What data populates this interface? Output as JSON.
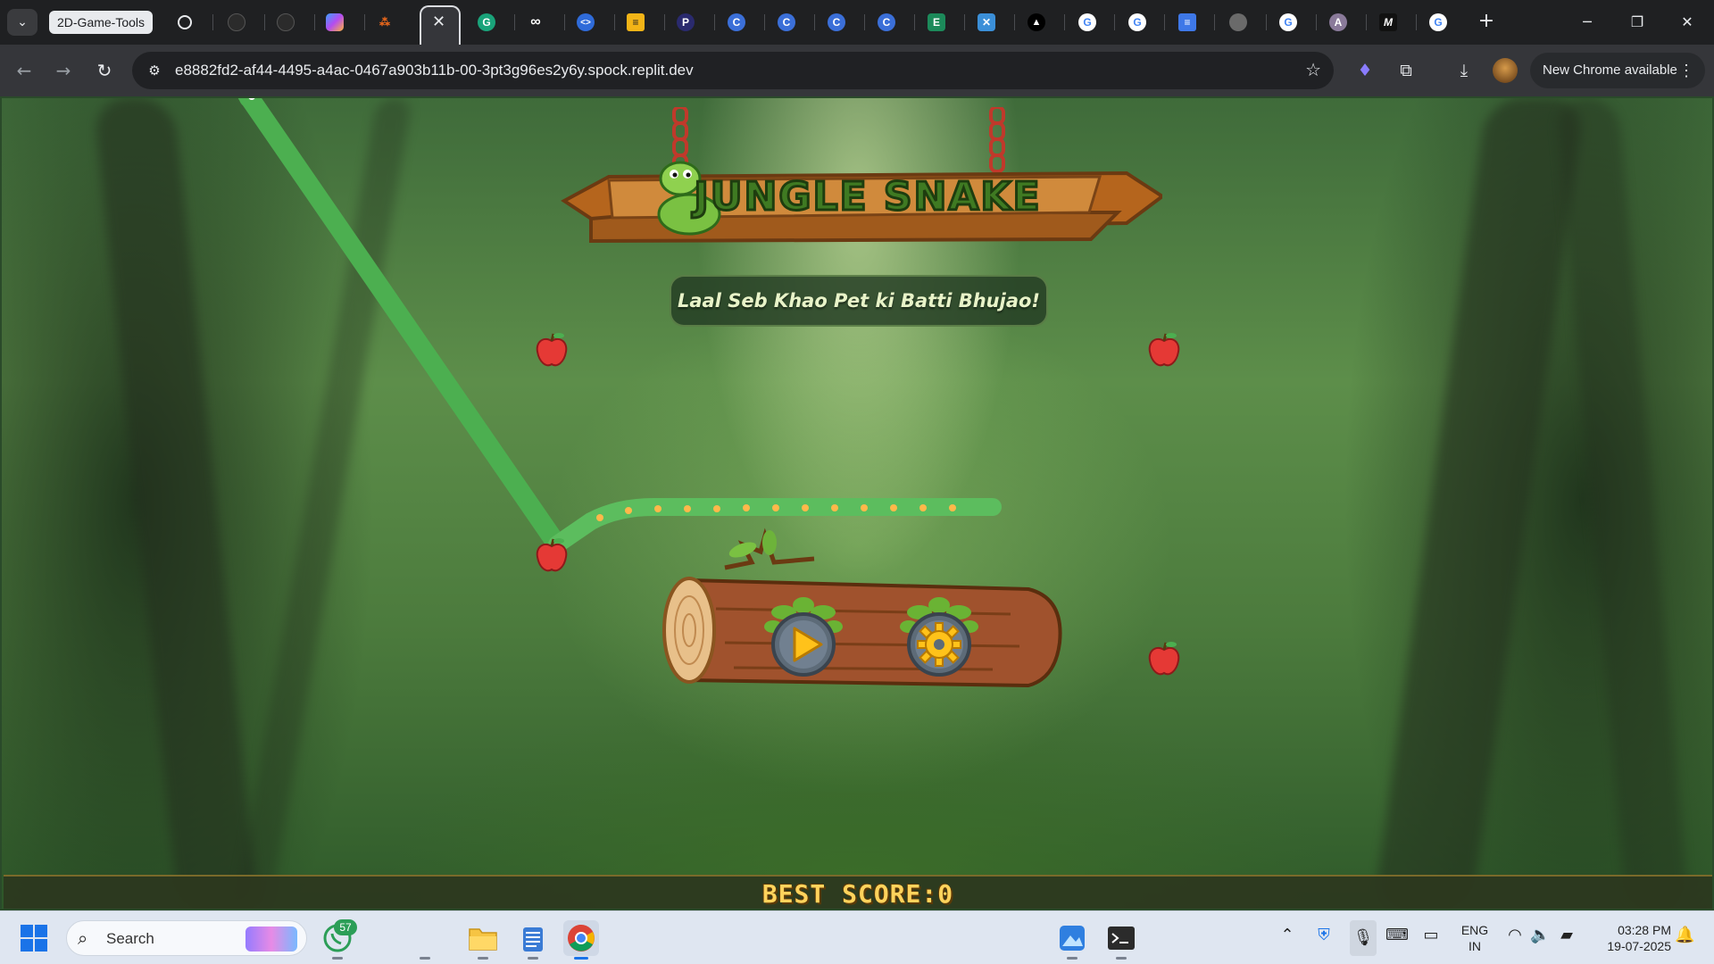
{
  "browser": {
    "tab_group_label": "2D-Game-Tools",
    "url": "e8882fd2-af44-4495-a4ac-0467a903b11b-00-3pt3g96es2y6y.spock.replit.dev",
    "update_label": "New Chrome available",
    "tab_icons": [
      "openai-icon",
      "github-icon",
      "github-icon",
      "copilot-icon",
      "app-icon",
      "replit-icon",
      "meta-icon",
      "code-icon",
      "sheets-icon",
      "p-icon",
      "c-icon",
      "c-icon",
      "c-icon",
      "c-icon",
      "excel-icon",
      "x-icon",
      "vercel-icon",
      "google-icon",
      "google-icon",
      "docs-icon",
      "dot-icon",
      "google-icon",
      "avatar-icon",
      "m-icon",
      "google-icon"
    ]
  },
  "game": {
    "title": "JUNGLE SNAKE",
    "tagline": "Laal Seb Khao Pet ki Batti Bhujao!",
    "best_score_label": "BEST SCORE:0",
    "apples": 4,
    "menu_buttons": [
      "play",
      "settings"
    ]
  },
  "taskbar": {
    "search_placeholder": "Search",
    "whatsapp_badge": "57",
    "language_line1": "ENG",
    "language_line2": "IN",
    "time": "03:28 PM",
    "date": "19-07-2025"
  },
  "colors": {
    "snake_green": "#4caf50",
    "score_gold": "#ffd35c",
    "chrome_dark": "#1f2022"
  }
}
